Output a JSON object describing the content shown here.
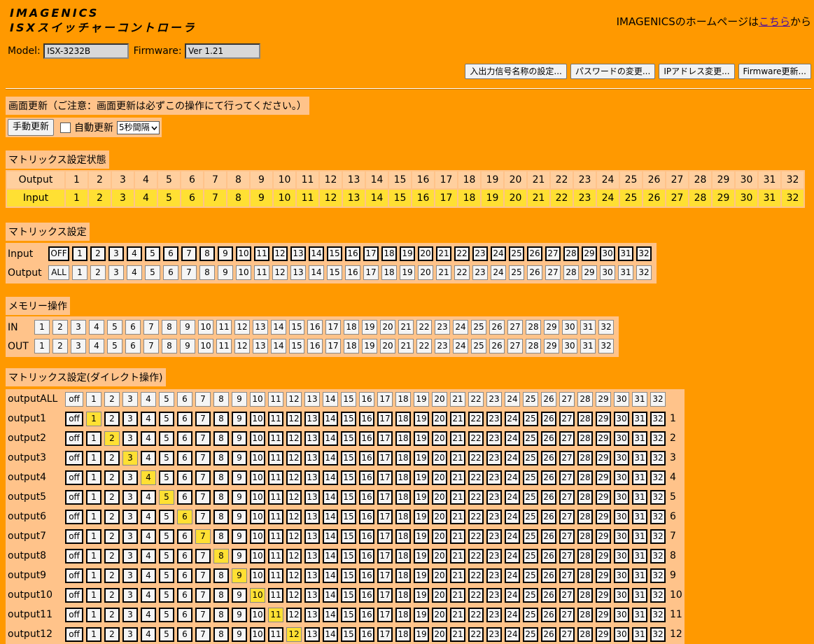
{
  "brand": {
    "line1": "IMAGENICS",
    "line2": "ISXスイッチャーコントローラ"
  },
  "homepage": {
    "prefix": "IMAGENICSのホームページは",
    "link": "こちら",
    "suffix": "から"
  },
  "device": {
    "model_label": "Model:",
    "model_value": "ISX-3232B",
    "firmware_label": "Firmware:",
    "firmware_value": "Ver 1.21"
  },
  "top_buttons": [
    "入出力信号名称の設定...",
    "パスワードの変更...",
    "IPアドレス変更...",
    "Firmware更新..."
  ],
  "refresh": {
    "title": "画面更新（ご注意：画面更新は必ずこの操作にて行ってください。）",
    "manual_button": "手動更新",
    "auto_checked": false,
    "auto_label": "自動更新",
    "interval_selected": "5秒間隔"
  },
  "status": {
    "title": "マトリックス設定状態",
    "output_label": "Output",
    "input_label": "Input",
    "outputs": [
      "1",
      "2",
      "3",
      "4",
      "5",
      "6",
      "7",
      "8",
      "9",
      "10",
      "11",
      "12",
      "13",
      "14",
      "15",
      "16",
      "17",
      "18",
      "19",
      "20",
      "21",
      "22",
      "23",
      "24",
      "25",
      "26",
      "27",
      "28",
      "29",
      "30",
      "31",
      "32"
    ],
    "inputs": [
      "1",
      "2",
      "3",
      "4",
      "5",
      "6",
      "7",
      "8",
      "9",
      "10",
      "11",
      "12",
      "13",
      "14",
      "15",
      "16",
      "17",
      "18",
      "19",
      "20",
      "21",
      "22",
      "23",
      "24",
      "25",
      "26",
      "27",
      "28",
      "29",
      "30",
      "31",
      "32"
    ]
  },
  "matrix_set": {
    "title": "マトリックス設定",
    "input_label": "Input",
    "input_first": "OFF",
    "output_label": "Output",
    "output_first": "ALL"
  },
  "memory": {
    "title": "メモリー操作",
    "in_label": "IN",
    "out_label": "OUT"
  },
  "direct": {
    "title": "マトリックス設定(ダイレクト操作)",
    "all_label": "outputALL",
    "off_label": "off",
    "rows": [
      {
        "label": "output1",
        "selected": 1,
        "tail": "1"
      },
      {
        "label": "output2",
        "selected": 2,
        "tail": "2"
      },
      {
        "label": "output3",
        "selected": 3,
        "tail": "3"
      },
      {
        "label": "output4",
        "selected": 4,
        "tail": "4"
      },
      {
        "label": "output5",
        "selected": 5,
        "tail": "5"
      },
      {
        "label": "output6",
        "selected": 6,
        "tail": "6"
      },
      {
        "label": "output7",
        "selected": 7,
        "tail": "7"
      },
      {
        "label": "output8",
        "selected": 8,
        "tail": "8"
      },
      {
        "label": "output9",
        "selected": 9,
        "tail": "9"
      },
      {
        "label": "output10",
        "selected": 10,
        "tail": "10"
      },
      {
        "label": "output11",
        "selected": 11,
        "tail": "11"
      },
      {
        "label": "output12",
        "selected": 12,
        "tail": "12"
      }
    ]
  },
  "channels": [
    "1",
    "2",
    "3",
    "4",
    "5",
    "6",
    "7",
    "8",
    "9",
    "10",
    "11",
    "12",
    "13",
    "14",
    "15",
    "16",
    "17",
    "18",
    "19",
    "20",
    "21",
    "22",
    "23",
    "24",
    "25",
    "26",
    "27",
    "28",
    "29",
    "30",
    "31",
    "32"
  ],
  "colors": {
    "background": "#ff9900",
    "panel": "#ffc38a",
    "highlight": "#ffe033"
  }
}
